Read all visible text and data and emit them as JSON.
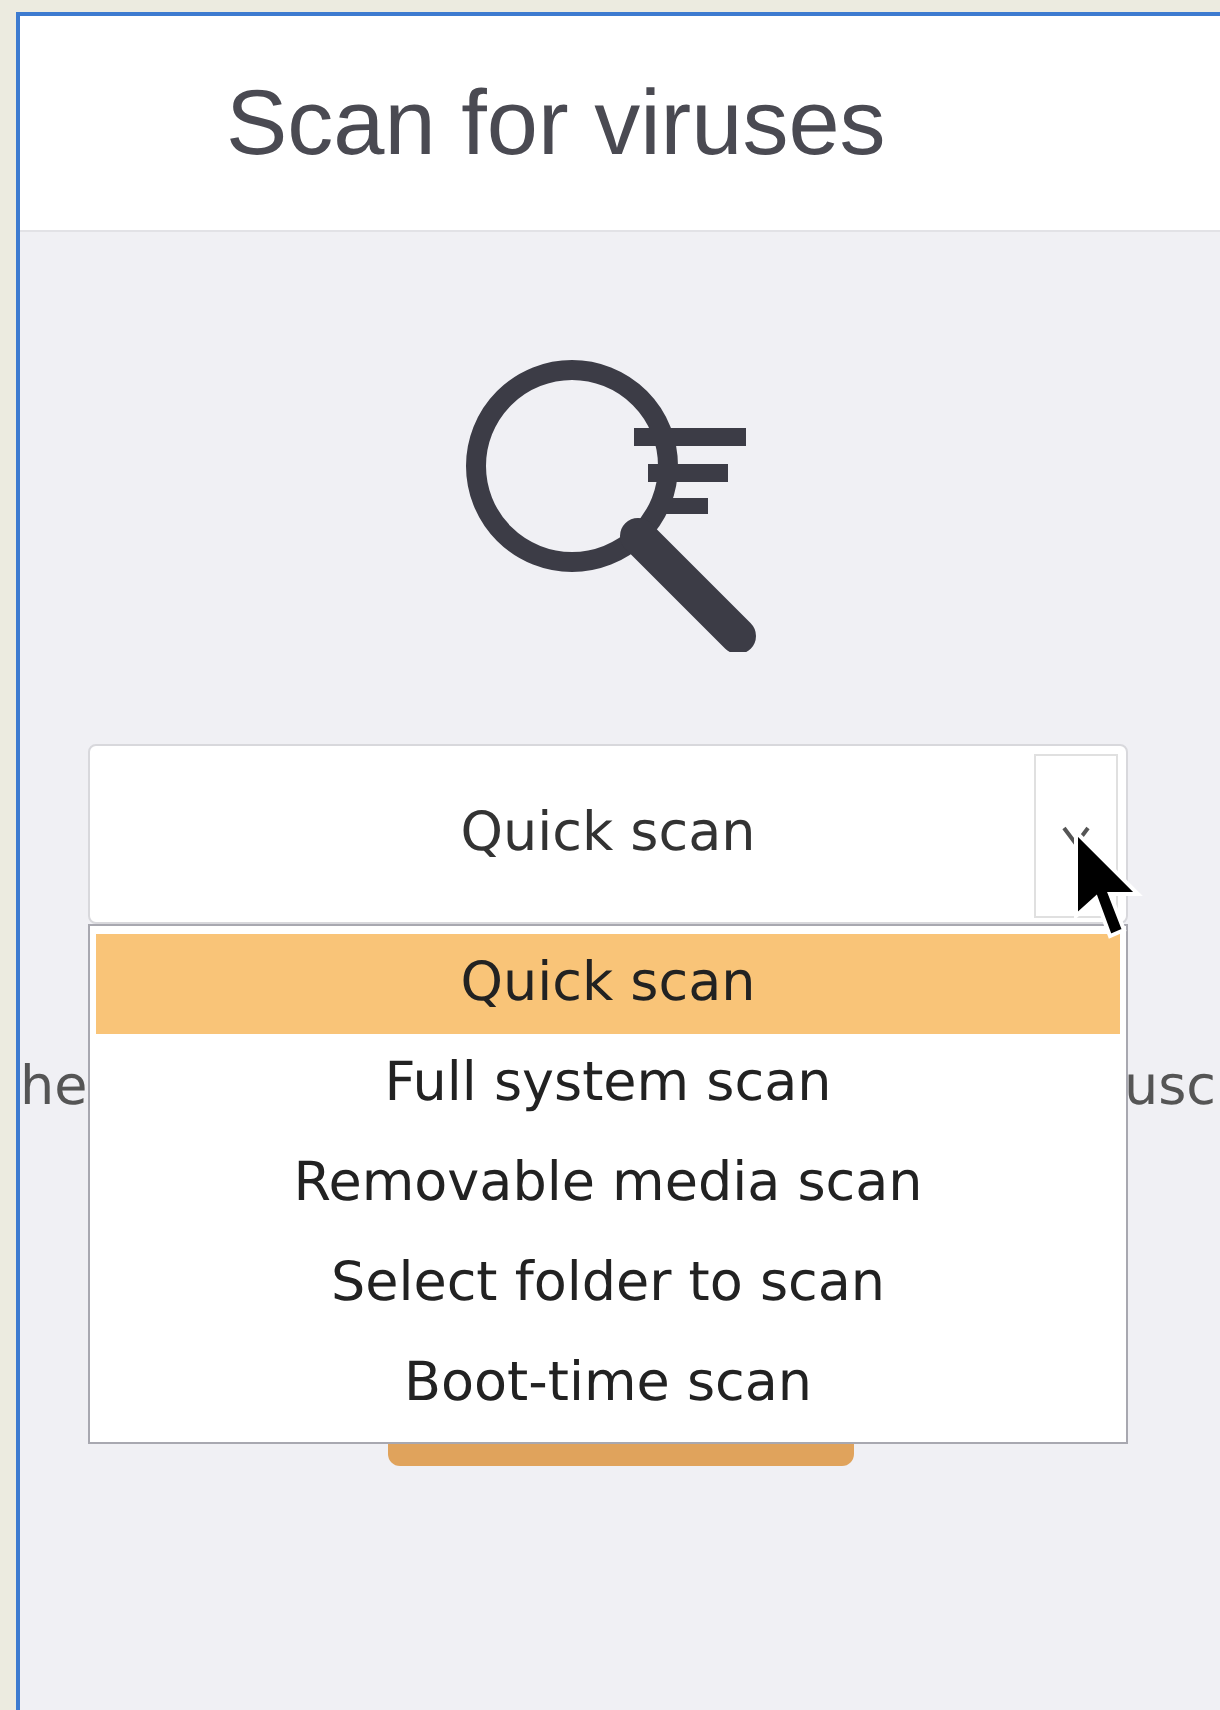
{
  "window": {
    "title": "Scan for viruses"
  },
  "scan_type_select": {
    "value": "Quick scan",
    "expanded": true,
    "options": [
      {
        "label": "Quick scan",
        "selected": true
      },
      {
        "label": "Full system scan",
        "selected": false
      },
      {
        "label": "Removable media scan",
        "selected": false
      },
      {
        "label": "Select folder to scan",
        "selected": false
      },
      {
        "label": "Boot-time scan",
        "selected": false
      }
    ]
  },
  "description": {
    "left_fragment": "he",
    "right_fragment": "usc"
  }
}
